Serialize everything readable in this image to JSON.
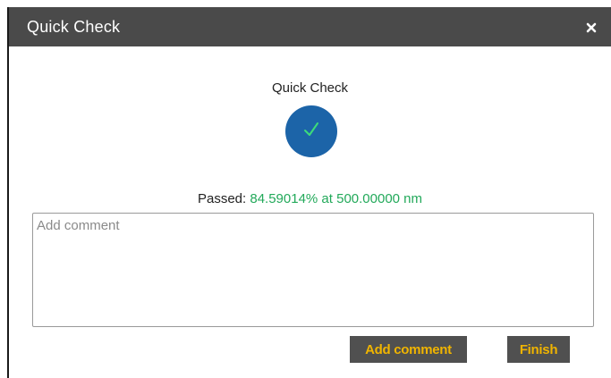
{
  "window": {
    "title": "Quick Check"
  },
  "check": {
    "heading": "Quick Check",
    "status": "passed",
    "status_color": "#22a95a",
    "circle_color": "#1c64a8",
    "result_label": "Passed:",
    "result_value": "84.59014% at 500.00000 nm"
  },
  "comment": {
    "placeholder": "Add comment",
    "value": ""
  },
  "buttons": {
    "add_comment_label": "Add comment",
    "finish_label": "Finish"
  },
  "icons": {
    "close": "close-icon",
    "status": "checkmark-icon"
  }
}
